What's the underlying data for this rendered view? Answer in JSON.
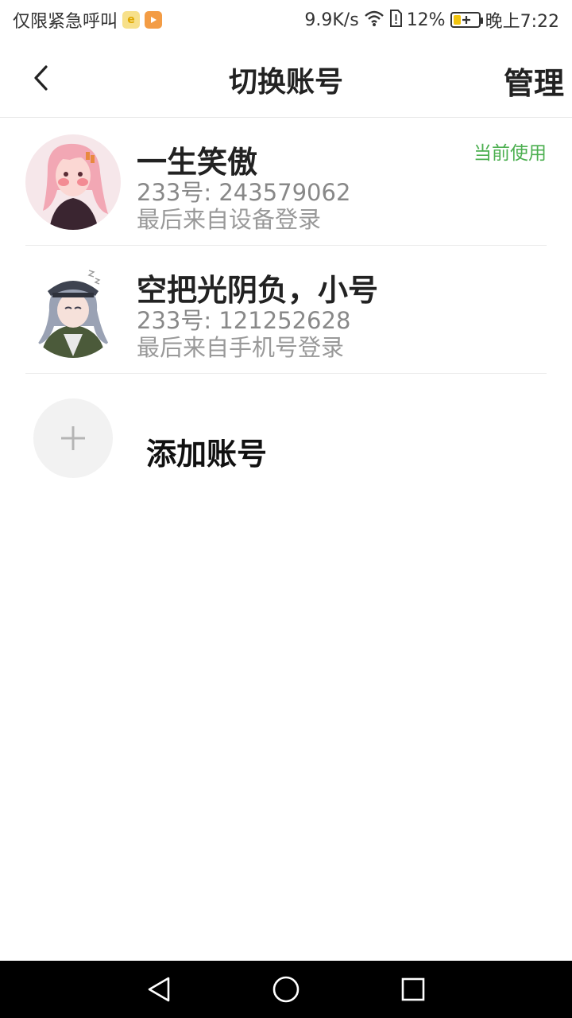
{
  "status_bar": {
    "carrier": "仅限紧急呼叫",
    "net_speed": "9.9K/s",
    "battery": "12%",
    "battery_level": 0.12,
    "time": "晚上7:22",
    "icons": [
      "browser-app-icon",
      "video-app-icon",
      "wifi-icon",
      "sim-alert-icon",
      "battery-icon"
    ]
  },
  "header": {
    "title": "切换账号",
    "manage": "管理"
  },
  "accounts": [
    {
      "name": "一生笑傲",
      "id": "233号: 243579062",
      "login": "最后来自设备登录",
      "badge": "当前使用"
    },
    {
      "name": "空把光阴负，小号",
      "id": "233号: 121252628",
      "login": "最后来自手机号登录"
    }
  ],
  "add_account": {
    "label": "添加账号"
  },
  "nav": {
    "icons": [
      "back-nav-icon",
      "home-nav-icon",
      "recents-nav-icon"
    ]
  },
  "colors": {
    "accent_green": "#4caf50",
    "battery_yellow": "#f1c40f"
  }
}
